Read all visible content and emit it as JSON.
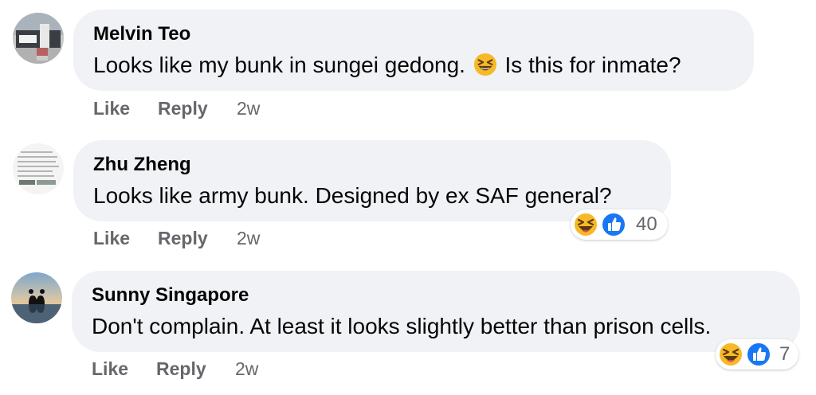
{
  "comments": [
    {
      "author": "Melvin Teo",
      "text_before": "Looks like my bunk in sungei gedong.",
      "text_after": "Is this for inmate?",
      "inline_emoji": "laughing-squinting-face-icon",
      "actions": {
        "like": "Like",
        "reply": "Reply",
        "time": "2w"
      }
    },
    {
      "author": "Zhu Zheng",
      "text": "Looks like army bunk. Designed by ex SAF general?",
      "actions": {
        "like": "Like",
        "reply": "Reply",
        "time": "2w"
      },
      "reactions": {
        "icons": [
          "haha-reaction-icon",
          "like-reaction-icon"
        ],
        "count": "40"
      }
    },
    {
      "author": "Sunny Singapore",
      "text": "Don't complain. At least it looks slightly better than prison cells.",
      "actions": {
        "like": "Like",
        "reply": "Reply",
        "time": "2w"
      },
      "reactions": {
        "icons": [
          "haha-reaction-icon",
          "like-reaction-icon"
        ],
        "count": "7"
      }
    }
  ],
  "colors": {
    "bubble_bg": "#f0f2f5",
    "secondary_text": "#65676b",
    "primary_text": "#050505",
    "like_blue": "#1877f2",
    "haha_yellow": "#f7b928"
  }
}
